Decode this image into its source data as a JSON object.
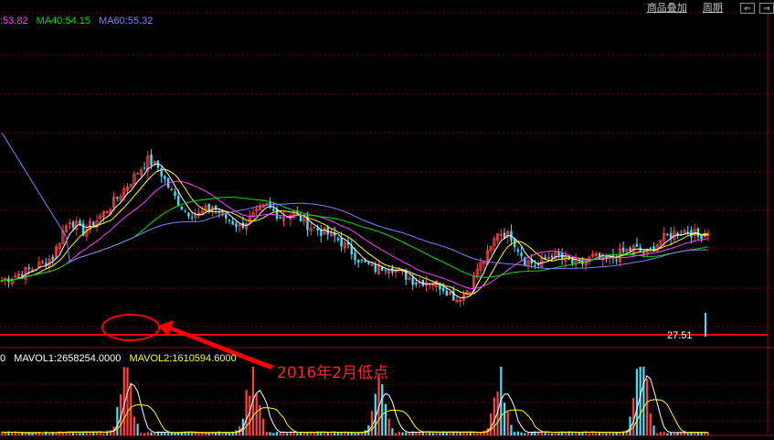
{
  "toolbar": {
    "overlay_label": "商品叠加",
    "period_label": "周期",
    "btn_left": "⇐",
    "btn_right": "⇒"
  },
  "ma_legend": [
    {
      "text": ":53.82",
      "color": "#ff40ff"
    },
    {
      "text": "MA40:54.15",
      "color": "#00e000"
    },
    {
      "text": "MA60:55.32",
      "color": "#8080ff"
    }
  ],
  "vol_legend": [
    {
      "text": "0",
      "color": "#ffffff"
    },
    {
      "text": "MAVOL1:2658254.0000",
      "color": "#ffffff"
    },
    {
      "text": "MAVOL2:1610594.6000",
      "color": "#ffff00"
    }
  ],
  "price_label": "27.51",
  "annotation": "2016年2月低点",
  "chart_data": {
    "type": "candlestick",
    "panels": [
      "price",
      "volume"
    ],
    "support_level": 27.51,
    "annotation": "2016年2月低点",
    "price_path": [
      [
        0,
        0.26
      ],
      [
        5,
        0.3
      ],
      [
        10,
        0.34
      ],
      [
        15,
        0.4
      ],
      [
        18,
        0.55
      ],
      [
        20,
        0.62
      ],
      [
        24,
        0.55
      ],
      [
        28,
        0.62
      ],
      [
        32,
        0.7
      ],
      [
        36,
        0.8
      ],
      [
        40,
        0.9
      ],
      [
        43,
        0.97
      ],
      [
        46,
        0.93
      ],
      [
        50,
        0.78
      ],
      [
        54,
        0.67
      ],
      [
        58,
        0.65
      ],
      [
        62,
        0.7
      ],
      [
        66,
        0.63
      ],
      [
        70,
        0.58
      ],
      [
        74,
        0.64
      ],
      [
        78,
        0.7
      ],
      [
        82,
        0.64
      ],
      [
        86,
        0.66
      ],
      [
        90,
        0.59
      ],
      [
        94,
        0.55
      ],
      [
        98,
        0.52
      ],
      [
        102,
        0.45
      ],
      [
        106,
        0.37
      ],
      [
        110,
        0.33
      ],
      [
        114,
        0.35
      ],
      [
        118,
        0.3
      ],
      [
        122,
        0.25
      ],
      [
        126,
        0.26
      ],
      [
        130,
        0.22
      ],
      [
        134,
        0.15
      ],
      [
        138,
        0.22
      ],
      [
        140,
        0.33
      ],
      [
        142,
        0.38
      ],
      [
        144,
        0.45
      ],
      [
        146,
        0.55
      ],
      [
        150,
        0.52
      ],
      [
        154,
        0.38
      ],
      [
        158,
        0.35
      ],
      [
        162,
        0.42
      ],
      [
        166,
        0.38
      ],
      [
        170,
        0.35
      ],
      [
        174,
        0.4
      ],
      [
        178,
        0.38
      ],
      [
        182,
        0.42
      ],
      [
        186,
        0.45
      ],
      [
        190,
        0.42
      ],
      [
        194,
        0.5
      ],
      [
        198,
        0.54
      ],
      [
        202,
        0.56
      ],
      [
        205,
        0.52
      ],
      [
        208,
        0.56
      ]
    ],
    "volume_spikes": [
      {
        "center": 0.18,
        "peak": 1.0
      },
      {
        "center": 0.36,
        "peak": 1.0
      },
      {
        "center": 0.54,
        "peak": 1.0
      },
      {
        "center": 0.71,
        "peak": 0.95
      },
      {
        "center": 0.91,
        "peak": 1.3
      }
    ]
  }
}
